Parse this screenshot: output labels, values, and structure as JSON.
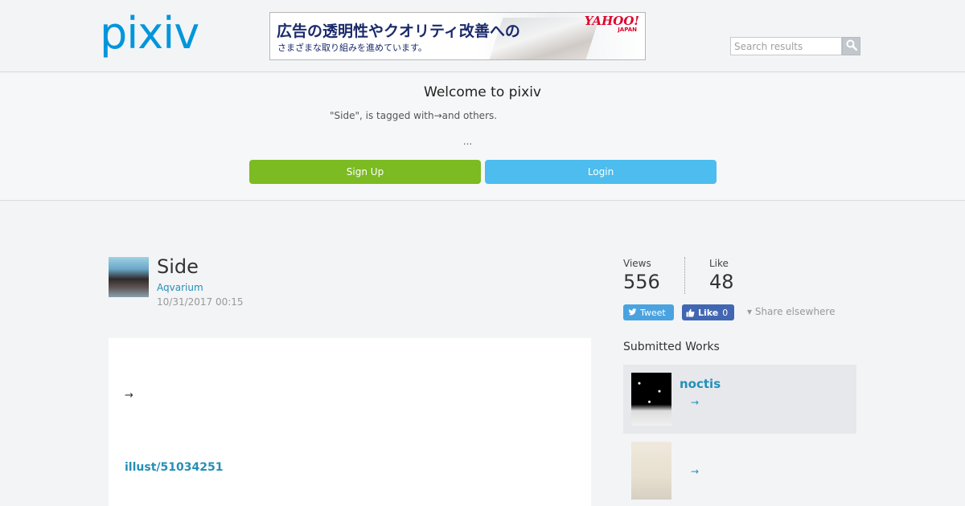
{
  "header": {
    "logo": "pixiv",
    "ad": {
      "line1": "広告の透明性やクオリティ改善への",
      "line2": "さまざまな取り組みを進めています。",
      "brand": "YAHOO!",
      "brand_sub": "JAPAN"
    },
    "search": {
      "placeholder": "Search results",
      "icon": "search-icon"
    }
  },
  "welcome": {
    "title": "Welcome to pixiv",
    "description": "\"Side\", is tagged with→and others.",
    "ellipsis": "...",
    "signup_label": "Sign Up",
    "login_label": "Login",
    "colors": {
      "signup": "#7cbb22",
      "login": "#4cbdee"
    }
  },
  "work": {
    "title": "Side",
    "author": "Aqvarium",
    "date": "10/31/2017 00:15",
    "content": {
      "arrow": "→",
      "link": "illust/51034251"
    }
  },
  "stats": {
    "views_label": "Views",
    "views_value": "556",
    "like_label": "Like",
    "like_value": "48",
    "tweet_label": "Tweet",
    "fb_like_label": "Like",
    "fb_like_count": "0",
    "share_elsewhere": "▾ Share elsewhere"
  },
  "submitted": {
    "title": "Submitted Works",
    "items": [
      {
        "title": "noctis",
        "arrow": "→"
      },
      {
        "title": "",
        "arrow": "→"
      }
    ]
  }
}
